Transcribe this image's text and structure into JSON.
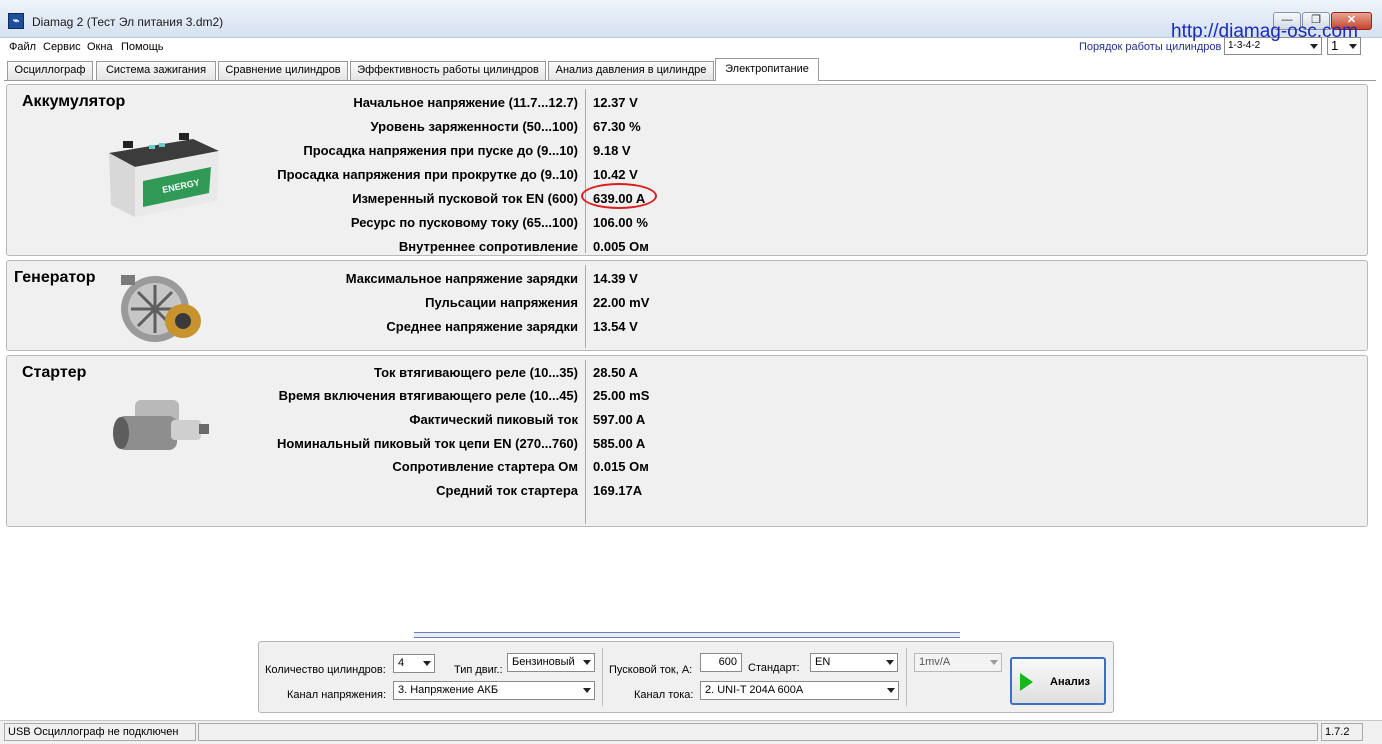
{
  "window": {
    "title": "Diamag 2 (Тест Эл питания 3.dm2)",
    "icon": "app-icon",
    "watermark": "http://diamag-osc.com",
    "min_glyph": "—",
    "max_glyph": "❐",
    "close_glyph": "✕"
  },
  "menu": {
    "file": "Файл",
    "service": "Сервис",
    "windows": "Окна",
    "help": "Помощь"
  },
  "cylinder_order": {
    "label": "Порядок работы цилиндров",
    "value": "1-3-4-2",
    "cylinder": "1"
  },
  "tabs": [
    {
      "label": "Осциллограф"
    },
    {
      "label": "Система зажигания"
    },
    {
      "label": "Сравнение цилиндров"
    },
    {
      "label": "Эффективность работы цилиндров"
    },
    {
      "label": "Анализ давления в цилиндре"
    },
    {
      "label": "Электропитание"
    }
  ],
  "battery": {
    "title": "Аккумулятор",
    "image_text": "ENERGY",
    "rows": [
      {
        "label": "Начальное напряжение (11.7...12.7)",
        "value": "12.37 V"
      },
      {
        "label": "Уровень заряженности (50...100)",
        "value": "67.30 %"
      },
      {
        "label": "Просадка напряжения при пуске до (9...10)",
        "value": "9.18 V"
      },
      {
        "label": "Просадка напряжения при прокрутке до  (9..10)",
        "value": "10.42 V"
      },
      {
        "label": "Измеренный пусковой ток  EN (600)",
        "value": "639.00 A"
      },
      {
        "label": "Ресурс по пусковому току (65...100)",
        "value": "106.00 %"
      },
      {
        "label": "Внутреннее сопротивление",
        "value": "0.005 Ом"
      }
    ]
  },
  "generator": {
    "title": "Генератор",
    "rows": [
      {
        "label": "Максимальное напряжение зарядки",
        "value": "14.39 V"
      },
      {
        "label": "Пульсации напряжения",
        "value": "22.00 mV"
      },
      {
        "label": "Среднее напряжение зарядки",
        "value": "13.54 V"
      }
    ]
  },
  "starter": {
    "title": "Стартер",
    "rows": [
      {
        "label": "Ток втягивающего реле (10...35)",
        "value": "28.50 A"
      },
      {
        "label": "Время включения втягивающего реле (10...45)",
        "value": "25.00 mS"
      },
      {
        "label": "Фактический пиковый ток",
        "value": "597.00 A"
      },
      {
        "label": "Номинальный пиковый ток цепи EN (270...760)",
        "value": "585.00 A"
      },
      {
        "label": "Сопротивление стартера Ом",
        "value": "0.015 Ом"
      },
      {
        "label": "Средний ток стартера",
        "value": "169.17A"
      }
    ]
  },
  "controls": {
    "cylinders_label": "Количество цилиндров:",
    "cylinders_value": "4",
    "engine_type_label": "Тип двиг.:",
    "engine_type_value": "Бензиновый",
    "voltage_channel_label": "Канал напряжения:",
    "voltage_channel_value": "3.  Напряжение АКБ",
    "start_current_label": "Пусковой ток, А:",
    "start_current_value": "600",
    "standard_label": "Стандарт:",
    "standard_value": "EN",
    "current_channel_label": "Канал тока:",
    "current_channel_value": "2.  UNI-T 204A 600A",
    "sensitivity_value": "1mv/A",
    "analyze_label": "Анализ"
  },
  "status": {
    "connection": "USB Осциллограф не подключен",
    "version": "1.7.2"
  },
  "colors": {
    "highlight": "#d91f1f",
    "play": "#18b81c",
    "watermark": "#1a2bb8"
  }
}
